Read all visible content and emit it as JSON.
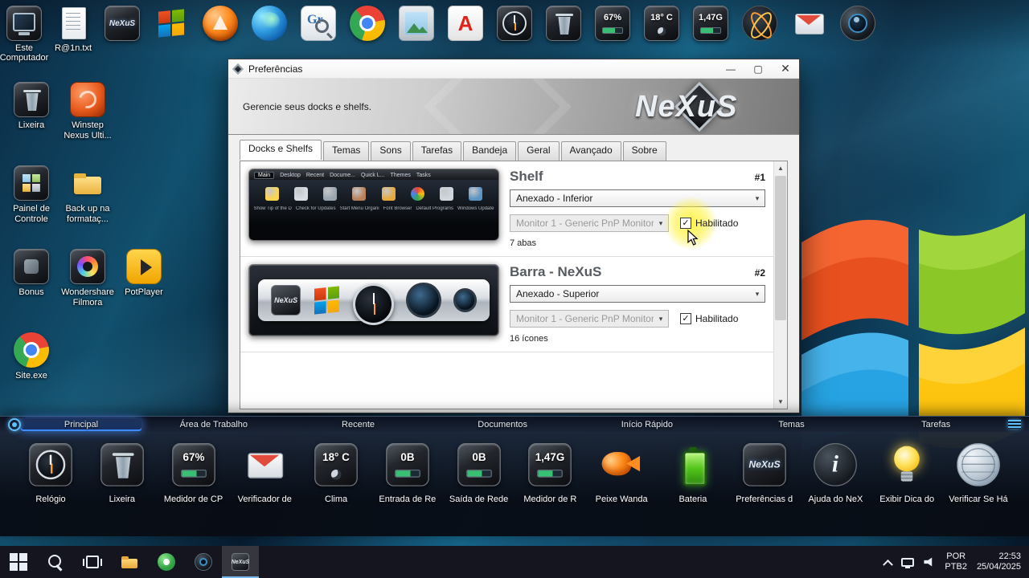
{
  "colors": {
    "highlight": "#fff23c",
    "shelf_active_tab": "#3d8bff",
    "taskbar_bg": "#15151f"
  },
  "top_dock": {
    "items": [
      {
        "icon": "computer",
        "label": "Este Computador"
      },
      {
        "icon": "text-file",
        "label": "R@1n.txt"
      },
      {
        "icon": "nexus",
        "text": "NeXuS"
      },
      {
        "icon": "windows"
      },
      {
        "icon": "avast"
      },
      {
        "icon": "edge"
      },
      {
        "icon": "gr",
        "text": "Gr"
      },
      {
        "icon": "chrome"
      },
      {
        "icon": "photo"
      },
      {
        "icon": "pdf"
      },
      {
        "icon": "clock"
      },
      {
        "icon": "recycle-bin"
      },
      {
        "icon": "meter",
        "badge": "67%"
      },
      {
        "icon": "weather",
        "badge": "18° C"
      },
      {
        "icon": "meter",
        "badge": "1,47G"
      },
      {
        "icon": "atom"
      },
      {
        "icon": "mail"
      },
      {
        "icon": "camera"
      }
    ]
  },
  "desktop_icons": [
    {
      "icon": "recycle-bin",
      "label": "Lixeira"
    },
    {
      "icon": "winstep",
      "label": "Winstep Nexus Ulti..."
    },
    {
      "icon": "control-panel",
      "label": "Painel de Controle"
    },
    {
      "icon": "folder",
      "label": "Back up na formataç..."
    },
    {
      "icon": "bonus",
      "label": "Bonus"
    },
    {
      "icon": "filmora",
      "label": "Wondershare Filmora"
    },
    {
      "icon": "potplayer",
      "label": "PotPlayer"
    },
    {
      "icon": "chrome",
      "label": "Site.exe"
    }
  ],
  "window": {
    "title": "Preferências",
    "subtitle": "Gerencie seus docks e shelfs.",
    "brand": "NeXuS",
    "controls": {
      "minimize": "—",
      "maximize": "▢",
      "close": "✕"
    },
    "tabs": [
      "Docks e Shelfs",
      "Temas",
      "Sons",
      "Tarefas",
      "Bandeja",
      "Geral",
      "Avançado",
      "Sobre"
    ],
    "active_tab": "Docks e Shelfs",
    "scrollbar": {
      "up": "▲",
      "down": "▼"
    },
    "entries": [
      {
        "title": "Shelf",
        "number": "#1",
        "attach": "Anexado - Inferior",
        "monitor": "Monitor 1 - Generic PnP Monitor (",
        "enabled_label": "Habilitado",
        "enabled": true,
        "highlight": true,
        "count": "7 abas",
        "thumb": "shelf",
        "thumb_tabs": [
          "Main",
          "Desktop",
          "Recent",
          "Docume...",
          "Quick L...",
          "Themes",
          "Tasks"
        ],
        "thumb_labels": [
          "Show Tip of the D",
          "Check for Updates",
          "Start Menu Organi",
          "Font Browser",
          "Default Programs",
          "Windows Update"
        ]
      },
      {
        "title": "Barra - NeXuS",
        "number": "#2",
        "attach": "Anexado - Superior",
        "monitor": "Monitor 1 - Generic PnP Monitor (",
        "enabled_label": "Habilitado",
        "enabled": true,
        "highlight": false,
        "count": "16 ícones",
        "thumb": "dock"
      }
    ]
  },
  "shelf": {
    "tabs": [
      "Principal",
      "Área de Trabalho",
      "Recente",
      "Documentos",
      "Início Rápido",
      "Temas",
      "Tarefas"
    ],
    "active_tab": "Principal",
    "items": [
      {
        "icon": "clock",
        "label": "Relógio"
      },
      {
        "icon": "recycle-bin",
        "label": "Lixeira"
      },
      {
        "icon": "meter",
        "label": "Medidor de CP",
        "badge": "67%"
      },
      {
        "icon": "mail",
        "label": "Verificador de"
      },
      {
        "icon": "weather",
        "label": "Clima",
        "badge": "18° C"
      },
      {
        "icon": "meter",
        "label": "Entrada de Re",
        "badge": "0B"
      },
      {
        "icon": "meter",
        "label": "Saída de Rede",
        "badge": "0B"
      },
      {
        "icon": "meter",
        "label": "Medidor de R",
        "badge": "1,47G"
      },
      {
        "icon": "fish",
        "label": "Peixe Wanda"
      },
      {
        "icon": "battery",
        "label": "Bateria"
      },
      {
        "icon": "nexus",
        "label": "Preferências d",
        "text": "NeXuS"
      },
      {
        "icon": "info",
        "label": "Ajuda do NeX"
      },
      {
        "icon": "bulb",
        "label": "Exibir Dica do"
      },
      {
        "icon": "globe",
        "label": "Verificar Se Há"
      }
    ]
  },
  "taskbar": {
    "pinned": [
      {
        "icon": "start",
        "name": "start-button"
      },
      {
        "icon": "search",
        "name": "search-button"
      },
      {
        "icon": "task-view",
        "name": "task-view-button"
      },
      {
        "icon": "folder",
        "name": "file-explorer-button"
      },
      {
        "icon": "media",
        "name": "media-app-button"
      },
      {
        "icon": "camera",
        "name": "camera-app-button"
      },
      {
        "icon": "nexus",
        "name": "nexus-app-button",
        "active": true,
        "text": "NeXuS"
      }
    ],
    "tray": {
      "language_line1": "POR",
      "language_line2": "PTB2",
      "time": "22:53",
      "date": "25/04/2025"
    }
  }
}
